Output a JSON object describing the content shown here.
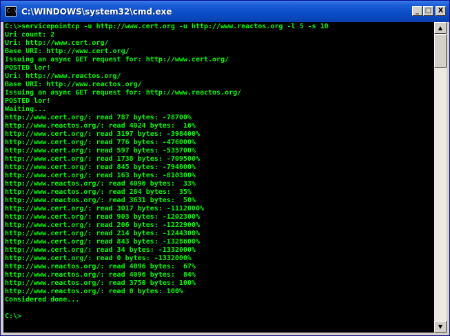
{
  "window": {
    "title": "C:\\WINDOWS\\system32\\cmd.exe",
    "icon": "cmd-icon",
    "icon_glyph": "C:\\",
    "buttons": {
      "minimize": "_",
      "maximize": "□",
      "close": "X"
    }
  },
  "console": {
    "colors": {
      "background": "#000000",
      "text": "#00ff00"
    },
    "lines": [
      "C:\\>servicepointcp -u http://www.cert.org -u http://www.reactos.org -l 5 -s 10",
      "Uri count: 2",
      "Uri: http://www.cert.org/",
      "Base URI: http://www.cert.org/",
      "Issuing an async GET request for: http://www.cert.org/",
      "POSTED lor!",
      "Uri: http://www.reactos.org/",
      "Base URI: http://www.reactos.org/",
      "Issuing an async GET request for: http://www.reactos.org/",
      "POSTED lor!",
      "Waiting...",
      "http://www.cert.org/: read 787 bytes: -78700%",
      "http://www.reactos.org/: read 4024 bytes:  16%",
      "http://www.cert.org/: read 3197 bytes: -398400%",
      "http://www.cert.org/: read 776 bytes: -476000%",
      "http://www.cert.org/: read 597 bytes: -535700%",
      "http://www.cert.org/: read 1738 bytes: -709500%",
      "http://www.cert.org/: read 845 bytes: -794000%",
      "http://www.cert.org/: read 163 bytes: -810300%",
      "http://www.reactos.org/: read 4096 bytes:  33%",
      "http://www.reactos.org/: read 284 bytes:  35%",
      "http://www.reactos.org/: read 3631 bytes:  50%",
      "http://www.cert.org/: read 3017 bytes: -1112000%",
      "http://www.cert.org/: read 903 bytes: -1202300%",
      "http://www.cert.org/: read 206 bytes: -1222900%",
      "http://www.cert.org/: read 214 bytes: -1244300%",
      "http://www.cert.org/: read 843 bytes: -1328600%",
      "http://www.cert.org/: read 34 bytes: -1332000%",
      "http://www.cert.org/: read 0 bytes: -1332000%",
      "http://www.reactos.org/: read 4096 bytes:  67%",
      "http://www.reactos.org/: read 4096 bytes:  84%",
      "http://www.reactos.org/: read 3750 bytes: 100%",
      "http://www.reactos.org/: read 0 bytes: 100%",
      "Considered done...",
      "",
      "C:\\>"
    ]
  },
  "scrollbar": {
    "up_arrow": "▲",
    "down_arrow": "▼"
  }
}
